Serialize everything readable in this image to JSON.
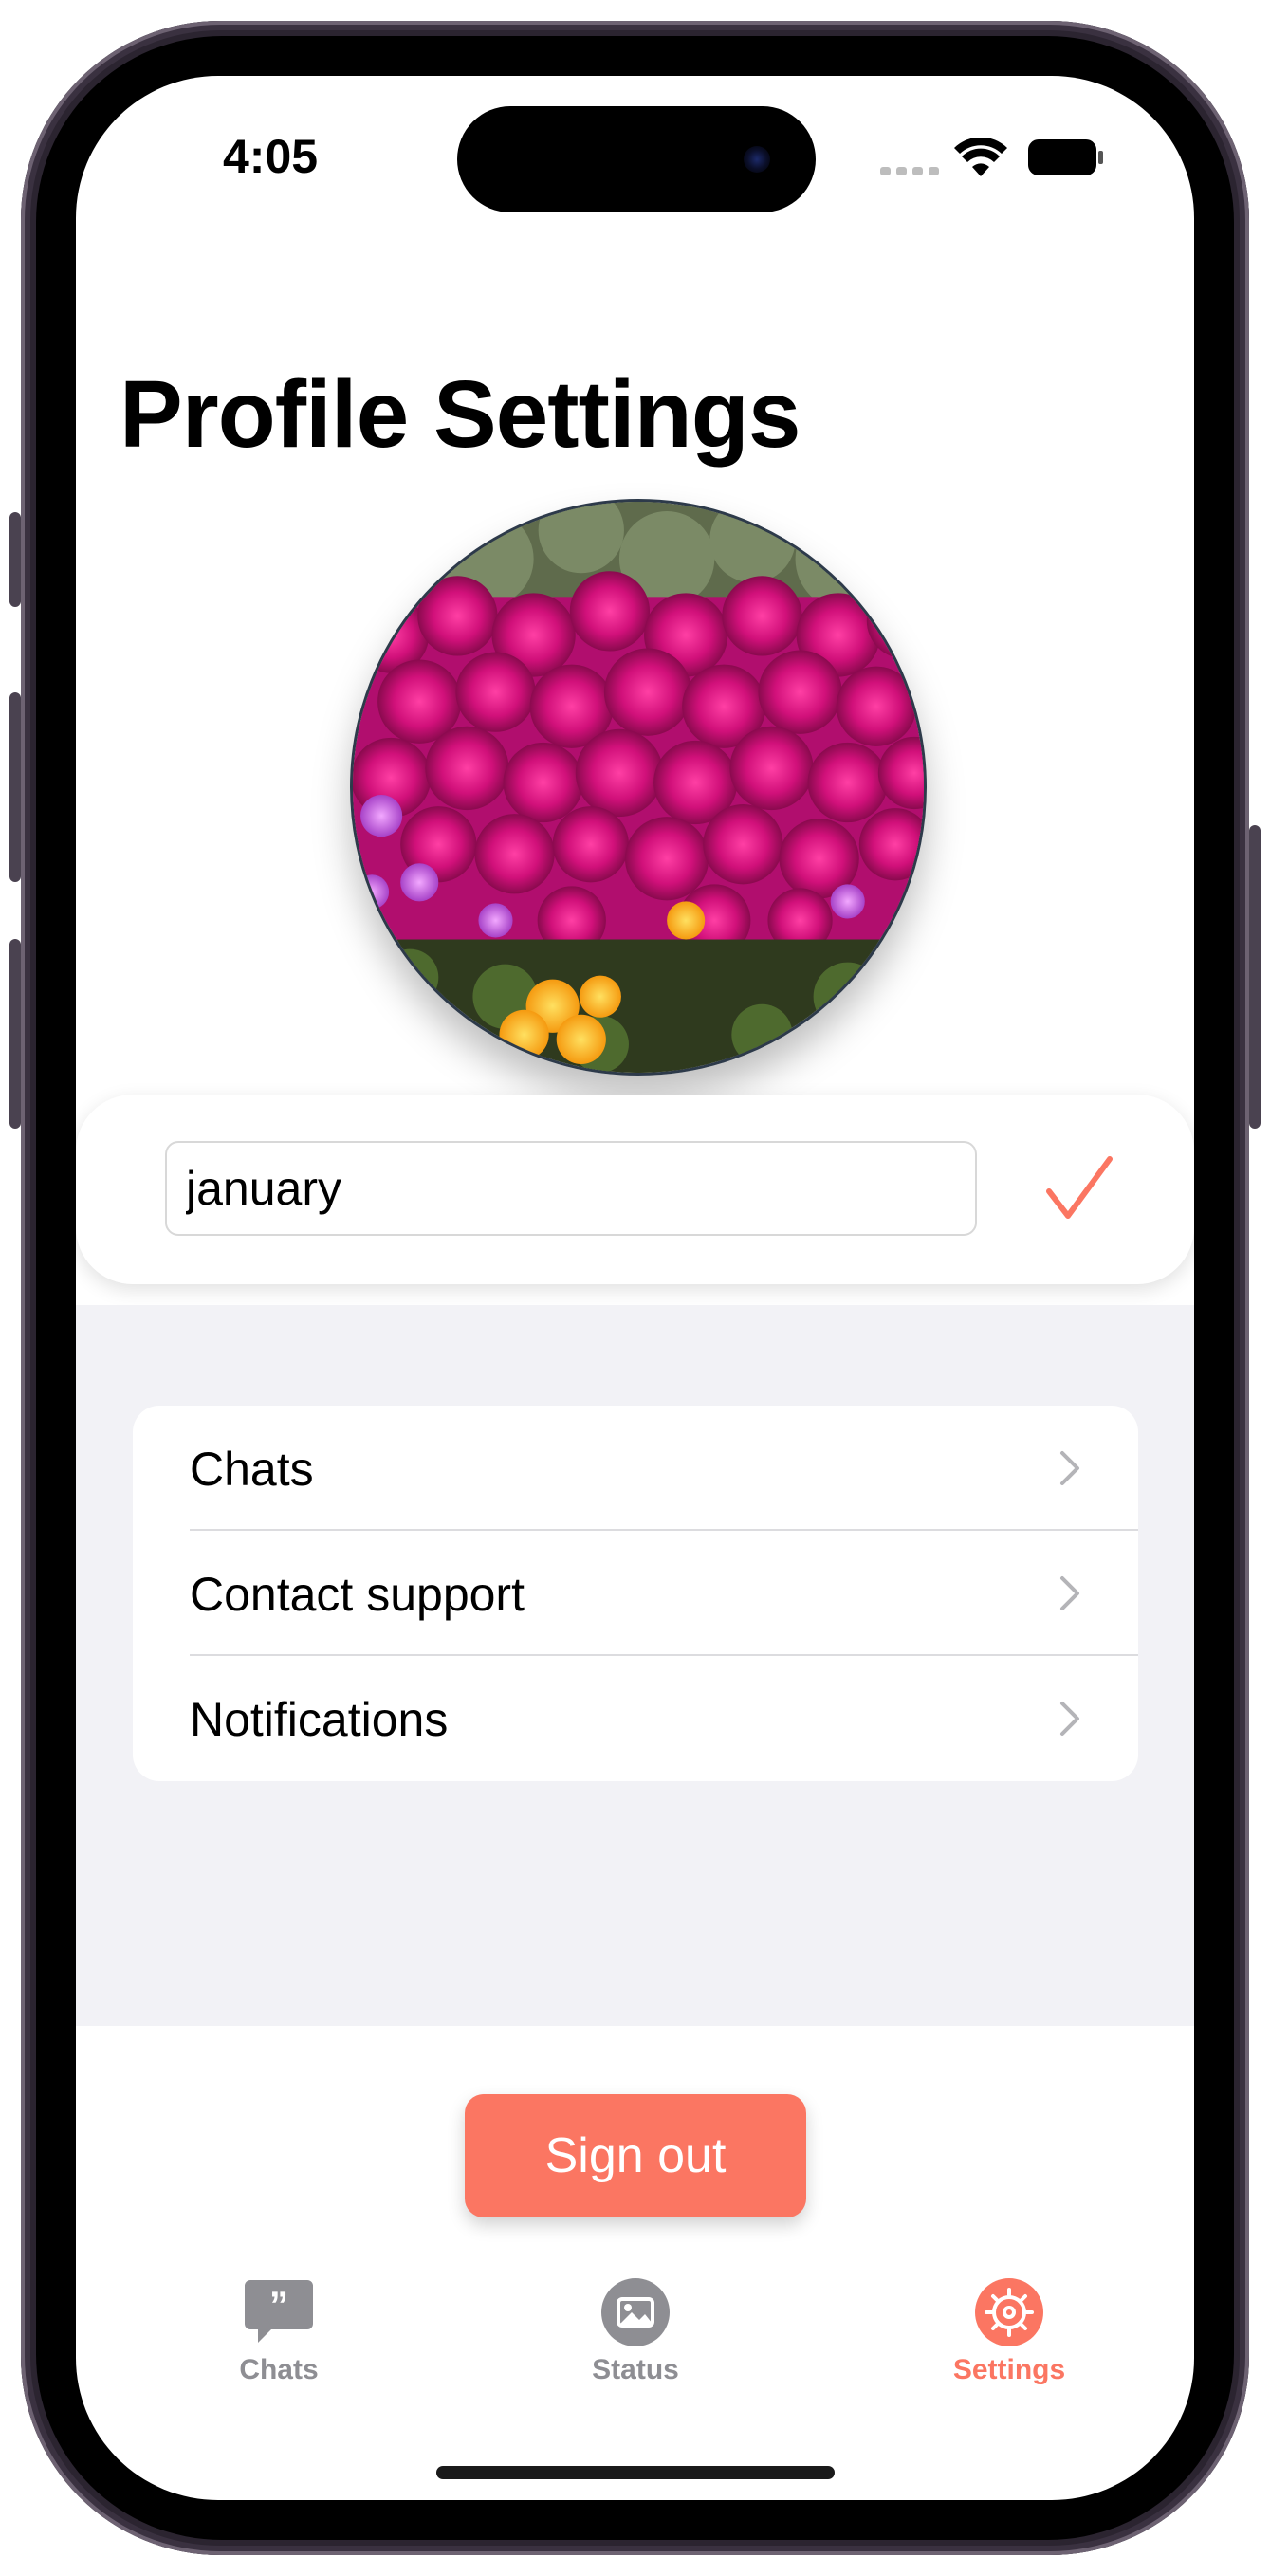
{
  "status_bar": {
    "time": "4:05"
  },
  "page": {
    "title": "Profile Settings"
  },
  "profile": {
    "name_value": "january",
    "confirm_icon": "checkmark-icon"
  },
  "menu": {
    "items": [
      {
        "label": "Chats"
      },
      {
        "label": "Contact support"
      },
      {
        "label": "Notifications"
      }
    ]
  },
  "actions": {
    "sign_out_label": "Sign out"
  },
  "tab_bar": {
    "tabs": [
      {
        "label": "Chats",
        "icon": "chat-bubble-icon",
        "active": false
      },
      {
        "label": "Status",
        "icon": "photo-icon",
        "active": false
      },
      {
        "label": "Settings",
        "icon": "gear-icon",
        "active": true
      }
    ]
  },
  "colors": {
    "accent": "#fb7662",
    "inactive": "#8e8e93",
    "grouped_background": "#f2f2f6"
  }
}
